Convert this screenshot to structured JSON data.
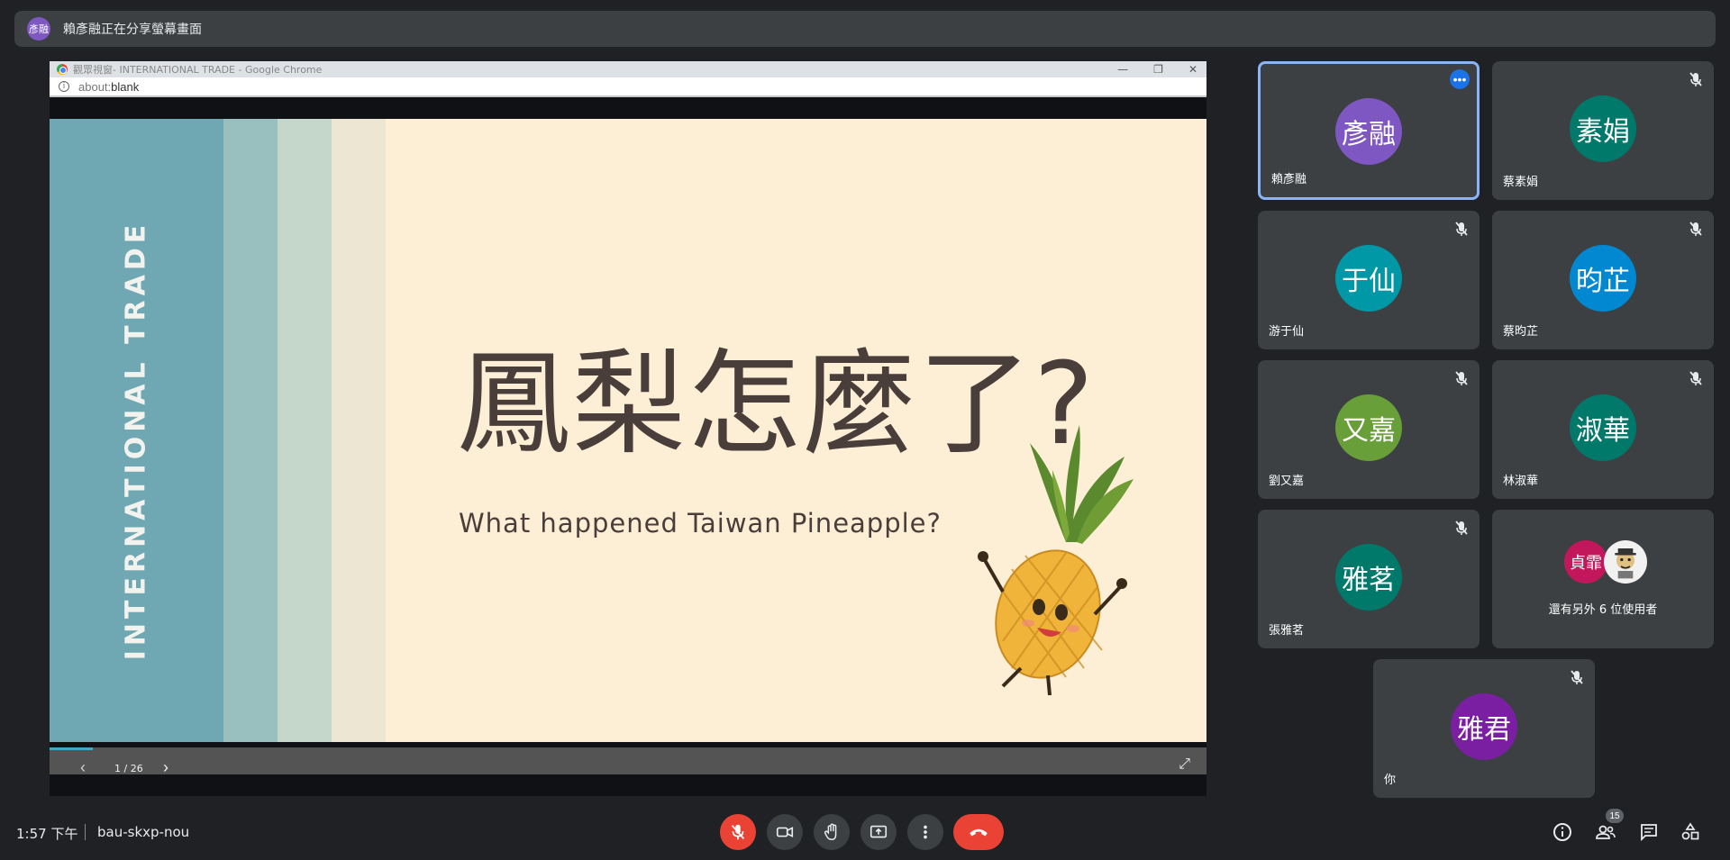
{
  "banner": {
    "avatar_text": "彥融",
    "text": "賴彥融正在分享螢幕畫面"
  },
  "shared_screen": {
    "window_title": "觀眾視窗- INTERNATIONAL TRADE - Google Chrome",
    "address": {
      "host": "about:",
      "path": "blank"
    },
    "window_controls": [
      "—",
      "❐",
      "✕"
    ],
    "slide": {
      "side_text": "INTERNATIONAL TRADE",
      "title": "鳳梨怎麼了?",
      "subtitle": "What happened Taiwan Pineapple?",
      "illustration": "pineapple-character"
    },
    "controls": {
      "page": "1 / 26",
      "prev_icon": "‹",
      "next_icon": "›",
      "fullscreen_icon": "⤢"
    }
  },
  "participants": [
    {
      "avatar_text": "彥融",
      "name": "賴彥融",
      "color": "#7e57c2",
      "active": true
    },
    {
      "avatar_text": "素娟",
      "name": "蔡素娟",
      "color": "#00796b",
      "muted": true
    },
    {
      "avatar_text": "于仙",
      "name": "游于仙",
      "color": "#0097a7",
      "muted": true
    },
    {
      "avatar_text": "昀芷",
      "name": "蔡昀芷",
      "color": "#0288d1",
      "muted": true
    },
    {
      "avatar_text": "又嘉",
      "name": "劉又嘉",
      "color": "#689f38",
      "muted": true
    },
    {
      "avatar_text": "淑華",
      "name": "林淑華",
      "color": "#00796b",
      "muted": true
    },
    {
      "avatar_text": "雅茗",
      "name": "張雅茗",
      "color": "#00796b",
      "muted": true
    },
    {
      "avatar_text": "雅君",
      "name": "你",
      "color": "#7b1fa2",
      "muted": true
    }
  ],
  "others_tile": {
    "avatar_text": "貞霏",
    "avatar_color": "#c2185b",
    "label": "還有另外 6 位使用者"
  },
  "bottom_bar": {
    "time": "1:57 下午",
    "meeting_code": "bau-skxp-nou",
    "people_count": "15"
  }
}
